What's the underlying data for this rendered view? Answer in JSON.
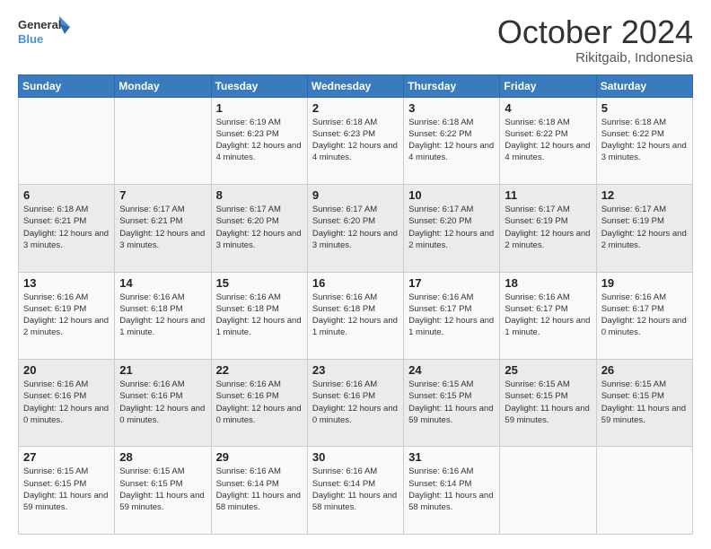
{
  "logo": {
    "line1": "General",
    "line2": "Blue"
  },
  "header": {
    "month": "October 2024",
    "location": "Rikitgaib, Indonesia"
  },
  "weekdays": [
    "Sunday",
    "Monday",
    "Tuesday",
    "Wednesday",
    "Thursday",
    "Friday",
    "Saturday"
  ],
  "weeks": [
    [
      {
        "day": "",
        "info": ""
      },
      {
        "day": "",
        "info": ""
      },
      {
        "day": "1",
        "info": "Sunrise: 6:19 AM\nSunset: 6:23 PM\nDaylight: 12 hours\nand 4 minutes."
      },
      {
        "day": "2",
        "info": "Sunrise: 6:18 AM\nSunset: 6:23 PM\nDaylight: 12 hours\nand 4 minutes."
      },
      {
        "day": "3",
        "info": "Sunrise: 6:18 AM\nSunset: 6:22 PM\nDaylight: 12 hours\nand 4 minutes."
      },
      {
        "day": "4",
        "info": "Sunrise: 6:18 AM\nSunset: 6:22 PM\nDaylight: 12 hours\nand 4 minutes."
      },
      {
        "day": "5",
        "info": "Sunrise: 6:18 AM\nSunset: 6:22 PM\nDaylight: 12 hours\nand 3 minutes."
      }
    ],
    [
      {
        "day": "6",
        "info": "Sunrise: 6:18 AM\nSunset: 6:21 PM\nDaylight: 12 hours\nand 3 minutes."
      },
      {
        "day": "7",
        "info": "Sunrise: 6:17 AM\nSunset: 6:21 PM\nDaylight: 12 hours\nand 3 minutes."
      },
      {
        "day": "8",
        "info": "Sunrise: 6:17 AM\nSunset: 6:20 PM\nDaylight: 12 hours\nand 3 minutes."
      },
      {
        "day": "9",
        "info": "Sunrise: 6:17 AM\nSunset: 6:20 PM\nDaylight: 12 hours\nand 3 minutes."
      },
      {
        "day": "10",
        "info": "Sunrise: 6:17 AM\nSunset: 6:20 PM\nDaylight: 12 hours\nand 2 minutes."
      },
      {
        "day": "11",
        "info": "Sunrise: 6:17 AM\nSunset: 6:19 PM\nDaylight: 12 hours\nand 2 minutes."
      },
      {
        "day": "12",
        "info": "Sunrise: 6:17 AM\nSunset: 6:19 PM\nDaylight: 12 hours\nand 2 minutes."
      }
    ],
    [
      {
        "day": "13",
        "info": "Sunrise: 6:16 AM\nSunset: 6:19 PM\nDaylight: 12 hours\nand 2 minutes."
      },
      {
        "day": "14",
        "info": "Sunrise: 6:16 AM\nSunset: 6:18 PM\nDaylight: 12 hours\nand 1 minute."
      },
      {
        "day": "15",
        "info": "Sunrise: 6:16 AM\nSunset: 6:18 PM\nDaylight: 12 hours\nand 1 minute."
      },
      {
        "day": "16",
        "info": "Sunrise: 6:16 AM\nSunset: 6:18 PM\nDaylight: 12 hours\nand 1 minute."
      },
      {
        "day": "17",
        "info": "Sunrise: 6:16 AM\nSunset: 6:17 PM\nDaylight: 12 hours\nand 1 minute."
      },
      {
        "day": "18",
        "info": "Sunrise: 6:16 AM\nSunset: 6:17 PM\nDaylight: 12 hours\nand 1 minute."
      },
      {
        "day": "19",
        "info": "Sunrise: 6:16 AM\nSunset: 6:17 PM\nDaylight: 12 hours\nand 0 minutes."
      }
    ],
    [
      {
        "day": "20",
        "info": "Sunrise: 6:16 AM\nSunset: 6:16 PM\nDaylight: 12 hours\nand 0 minutes."
      },
      {
        "day": "21",
        "info": "Sunrise: 6:16 AM\nSunset: 6:16 PM\nDaylight: 12 hours\nand 0 minutes."
      },
      {
        "day": "22",
        "info": "Sunrise: 6:16 AM\nSunset: 6:16 PM\nDaylight: 12 hours\nand 0 minutes."
      },
      {
        "day": "23",
        "info": "Sunrise: 6:16 AM\nSunset: 6:16 PM\nDaylight: 12 hours\nand 0 minutes."
      },
      {
        "day": "24",
        "info": "Sunrise: 6:15 AM\nSunset: 6:15 PM\nDaylight: 11 hours\nand 59 minutes."
      },
      {
        "day": "25",
        "info": "Sunrise: 6:15 AM\nSunset: 6:15 PM\nDaylight: 11 hours\nand 59 minutes."
      },
      {
        "day": "26",
        "info": "Sunrise: 6:15 AM\nSunset: 6:15 PM\nDaylight: 11 hours\nand 59 minutes."
      }
    ],
    [
      {
        "day": "27",
        "info": "Sunrise: 6:15 AM\nSunset: 6:15 PM\nDaylight: 11 hours\nand 59 minutes."
      },
      {
        "day": "28",
        "info": "Sunrise: 6:15 AM\nSunset: 6:15 PM\nDaylight: 11 hours\nand 59 minutes."
      },
      {
        "day": "29",
        "info": "Sunrise: 6:16 AM\nSunset: 6:14 PM\nDaylight: 11 hours\nand 58 minutes."
      },
      {
        "day": "30",
        "info": "Sunrise: 6:16 AM\nSunset: 6:14 PM\nDaylight: 11 hours\nand 58 minutes."
      },
      {
        "day": "31",
        "info": "Sunrise: 6:16 AM\nSunset: 6:14 PM\nDaylight: 11 hours\nand 58 minutes."
      },
      {
        "day": "",
        "info": ""
      },
      {
        "day": "",
        "info": ""
      }
    ]
  ]
}
